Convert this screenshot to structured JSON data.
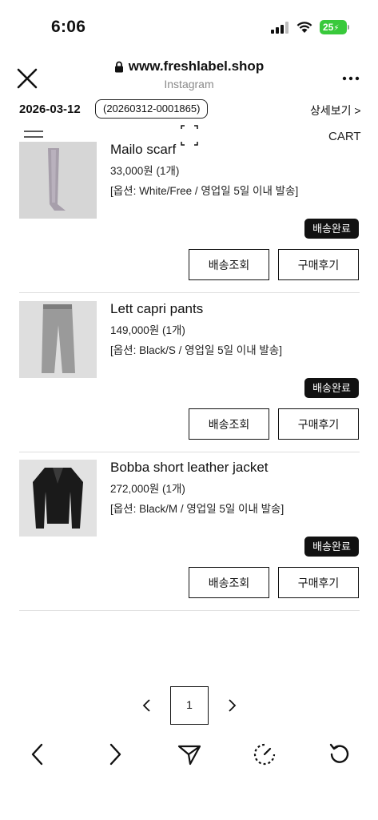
{
  "status_bar": {
    "time": "6:06",
    "battery": "25"
  },
  "browser": {
    "url": "www.freshlabel.shop",
    "source": "Instagram"
  },
  "order": {
    "date": "2026-03-12",
    "number": "(20260312-0001865)",
    "detail_link": "상세보기 >"
  },
  "nav": {
    "cart": "CART"
  },
  "items": [
    {
      "name": "Mailo scarf",
      "price": "33,000원 (1개)",
      "option": "[옵션: White/Free / 영업일 5일 이내 발송]",
      "status": "배송완료",
      "track": "배송조회",
      "review": "구매후기"
    },
    {
      "name": "Lett capri pants",
      "price": "149,000원 (1개)",
      "option": "[옵션: Black/S / 영업일 5일 이내 발송]",
      "status": "배송완료",
      "track": "배송조회",
      "review": "구매후기"
    },
    {
      "name": "Bobba short leather jacket",
      "price": "272,000원 (1개)",
      "option": "[옵션: Black/M / 영업일 5일 이내 발송]",
      "status": "배송완료",
      "track": "배송조회",
      "review": "구매후기"
    }
  ],
  "pagination": {
    "current": "1"
  },
  "colors": {
    "accent": "#111111",
    "battery": "#39c93b",
    "background": "#ffffff"
  },
  "icons": [
    "close-icon",
    "lock-icon",
    "more-icon",
    "menu-icon",
    "back-icon",
    "forward-icon",
    "share-icon",
    "speed-icon",
    "reload-icon"
  ]
}
